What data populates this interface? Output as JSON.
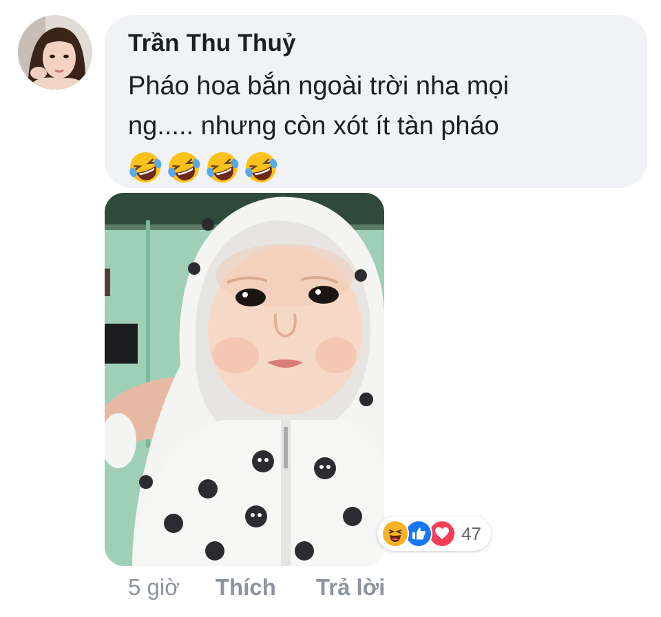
{
  "comment": {
    "author": "Trần Thu Thuỷ",
    "text_line1": "Pháo hoa bắn ngoài trời nha mọi",
    "text_line2": "ng..... nhưng còn xót ít tàn pháo",
    "emoji": [
      "rolling-on-floor-laughing",
      "rolling-on-floor-laughing",
      "rolling-on-floor-laughing",
      "rolling-on-floor-laughing"
    ],
    "attachment": "photo of a baby wearing a white hooded jacket with cat prints"
  },
  "reactions": {
    "icons": [
      "haha-icon",
      "like-icon",
      "love-icon"
    ],
    "count": "47"
  },
  "actions": {
    "time": "5 giờ",
    "like_label": "Thích",
    "reply_label": "Trả lời"
  },
  "colors": {
    "bubble_bg": "#f0f2f5",
    "text": "#1c1e21",
    "meta": "#8d949e",
    "like_blue": "#1877f2",
    "love_red": "#f33e58",
    "haha_yellow": "#f7b125"
  }
}
